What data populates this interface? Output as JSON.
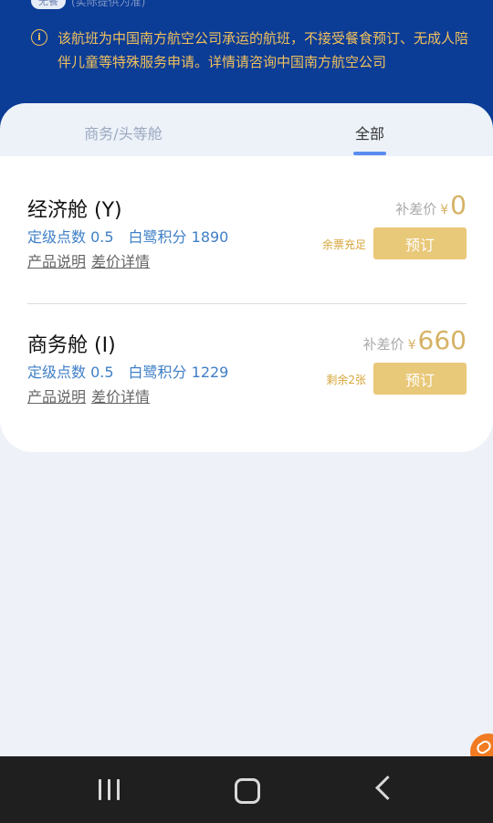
{
  "top": {
    "meal_badge": "无餐",
    "meal_note": "(实际提供为准)",
    "notice": "该航班为中国南方航空公司承运的航班，不接受餐食预订、无成人陪伴儿童等特殊服务申请。详情请咨询中国南方航空公司"
  },
  "tabs": {
    "business_first": "商务/头等舱",
    "all": "全部",
    "active": "全部"
  },
  "fares": [
    {
      "cabin": "经济舱 (Y)",
      "grade_points": "定级点数 0.5",
      "egret_points": "白鹭积分 1890",
      "product_link": "产品说明",
      "diff_link": "差价详情",
      "price_label": "补差价",
      "currency": "¥",
      "amount": "0",
      "availability": "余票充足",
      "book_label": "预订"
    },
    {
      "cabin": "商务舱 (I)",
      "grade_points": "定级点数 0.5",
      "egret_points": "白鹭积分 1229",
      "product_link": "产品说明",
      "diff_link": "差价详情",
      "price_label": "补差价",
      "currency": "¥",
      "amount": "660",
      "availability": "剩余2张",
      "book_label": "预订"
    }
  ],
  "colors": {
    "header_blue": "#0b3c96",
    "notice_text": "#f1c15d",
    "points_blue": "#3f7fc6",
    "price_gold": "#d6b265",
    "button_gold": "#e8c879",
    "float_orange": "#f07b22"
  },
  "icons": {
    "notice": "info-icon",
    "float": "link-icon",
    "nav": [
      "recent-apps-icon",
      "home-icon",
      "back-icon"
    ]
  }
}
